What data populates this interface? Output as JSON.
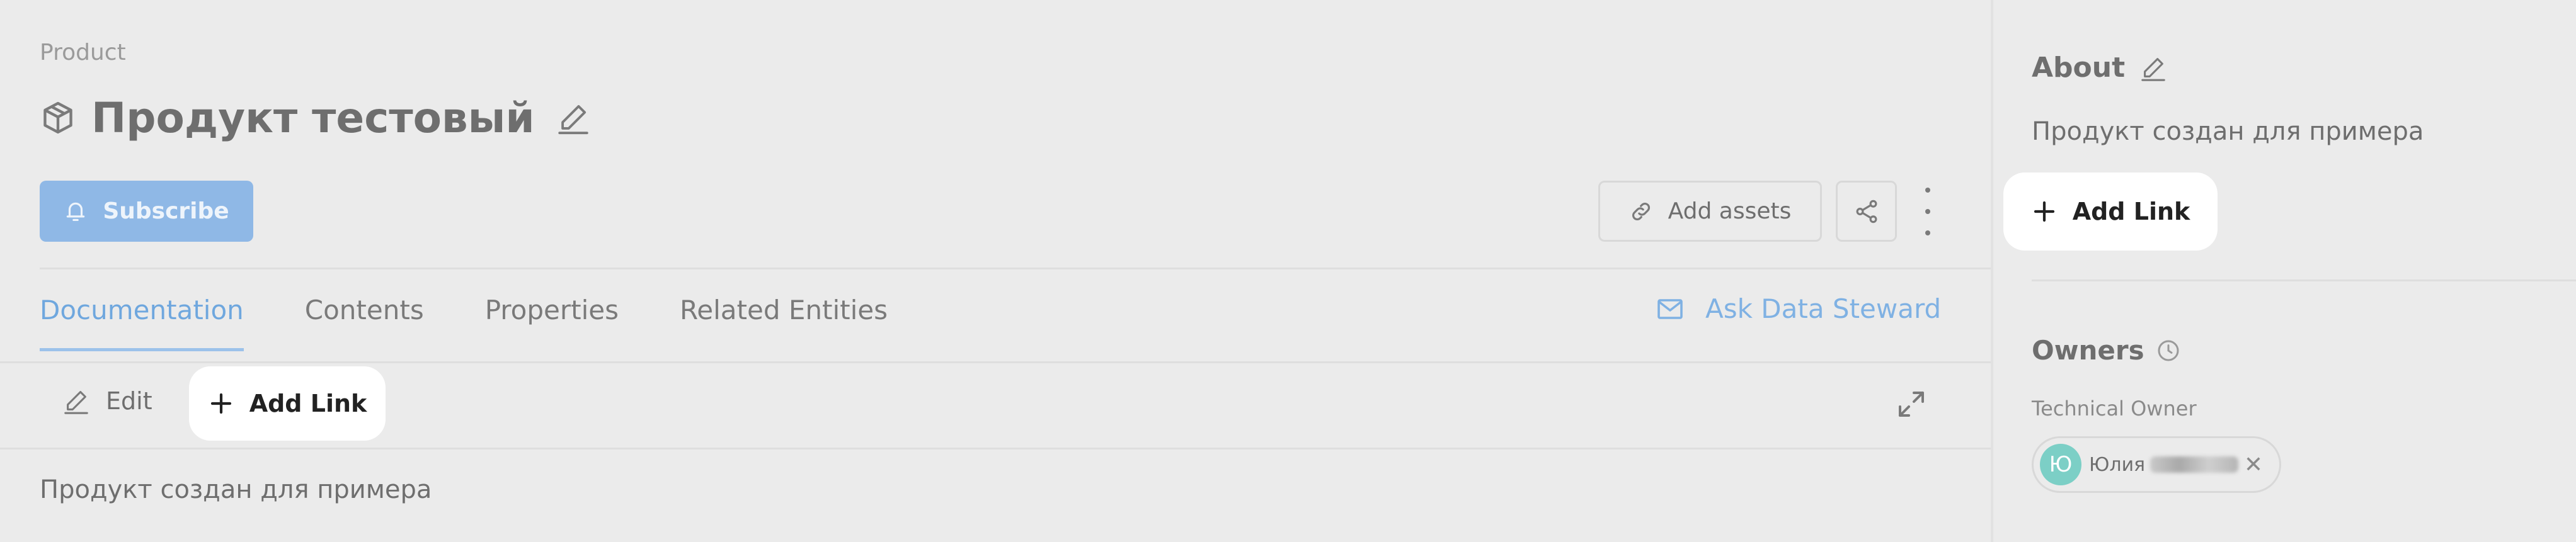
{
  "entity": {
    "type_label": "Product",
    "title": "Продукт тестовый"
  },
  "actions": {
    "subscribe_label": "Subscribe",
    "add_assets_label": "Add assets"
  },
  "tabs": [
    {
      "label": "Documentation",
      "active": true
    },
    {
      "label": "Contents",
      "active": false
    },
    {
      "label": "Properties",
      "active": false
    },
    {
      "label": "Related Entities",
      "active": false
    }
  ],
  "ask_steward_label": "Ask Data Steward",
  "docs_toolbar": {
    "edit_label": "Edit",
    "add_link_label": "Add Link"
  },
  "description": "Продукт создан для примера",
  "sidebar": {
    "about_title": "About",
    "about_description": "Продукт создан для примера",
    "add_link_label": "Add Link",
    "owners_title": "Owners",
    "technical_owner_label": "Technical Owner",
    "owner": {
      "avatar_initial": "Ю",
      "name": "Юлия"
    }
  },
  "colors": {
    "accent": "#6fa7de",
    "subscribe_bg": "#8fb8e6",
    "avatar_bg": "#7ccfc6",
    "page_bg": "#ebebeb"
  },
  "icons": {
    "entity": "cube-icon",
    "edit": "pencil-icon",
    "subscribe": "bell-icon",
    "add_assets": "link-icon",
    "share": "share-icon",
    "more": "more-vertical-icon",
    "ask": "mail-icon",
    "add_link": "plus-icon",
    "expand": "expand-icon",
    "owners_info": "clock-icon",
    "remove": "close-icon"
  }
}
